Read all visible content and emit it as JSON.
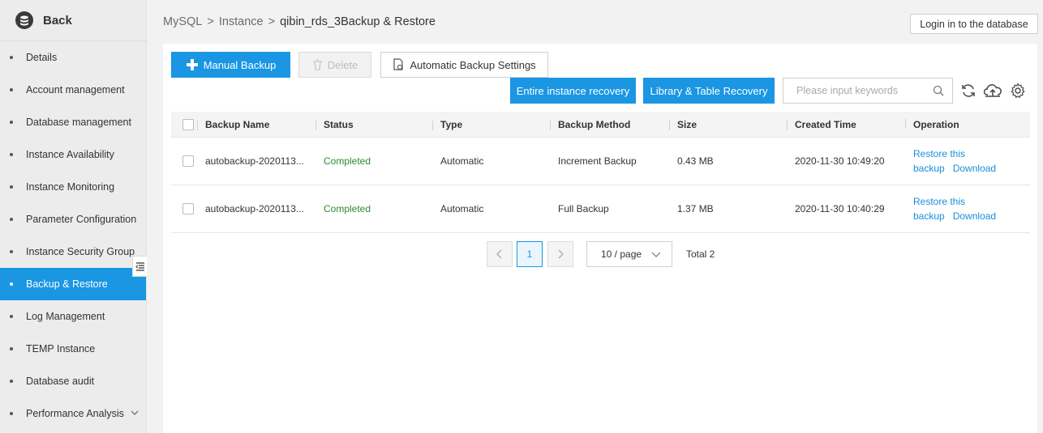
{
  "sidebar": {
    "back_label": "Back",
    "items": [
      {
        "label": "Details"
      },
      {
        "label": "Account management"
      },
      {
        "label": "Database management"
      },
      {
        "label": "Instance Availability"
      },
      {
        "label": "Instance Monitoring"
      },
      {
        "label": "Parameter Configuration"
      },
      {
        "label": "Instance Security Group"
      },
      {
        "label": "Backup & Restore",
        "active": true
      },
      {
        "label": "Log Management"
      },
      {
        "label": "TEMP Instance"
      },
      {
        "label": "Database audit"
      },
      {
        "label": "Performance Analysis"
      }
    ]
  },
  "header": {
    "breadcrumb": [
      "MySQL",
      "Instance",
      "qibin_rds_3Backup & Restore"
    ],
    "separator": ">",
    "login_button": "Login in to the database"
  },
  "toolbar": {
    "manual_backup": "Manual Backup",
    "delete": "Delete",
    "auto_settings": "Automatic Backup Settings",
    "entire_recovery": "Entire instance recovery",
    "library_recovery": "Library & Table Recovery",
    "search_placeholder": "Please input keywords"
  },
  "table": {
    "columns": [
      "Backup Name",
      "Status",
      "Type",
      "Backup Method",
      "Size",
      "Created Time",
      "Operation"
    ],
    "rows": [
      {
        "name": "autobackup-2020113...",
        "status": "Completed",
        "type": "Automatic",
        "method": "Increment Backup",
        "size": "0.43 MB",
        "time": "2020-11-30 10:49:20",
        "op_restore": "Restore this",
        "op_restore2": "backup",
        "op_download": "Download"
      },
      {
        "name": "autobackup-2020113...",
        "status": "Completed",
        "type": "Automatic",
        "method": "Full Backup",
        "size": "1.37 MB",
        "time": "2020-11-30 10:40:29",
        "op_restore": "Restore this",
        "op_restore2": "backup",
        "op_download": "Download"
      }
    ]
  },
  "pagination": {
    "current_page": "1",
    "page_size": "10 / page",
    "total": "Total 2"
  },
  "colors": {
    "accent": "#1a96e3",
    "status_ok": "#2e8b2e",
    "link": "#1a8ed8"
  }
}
